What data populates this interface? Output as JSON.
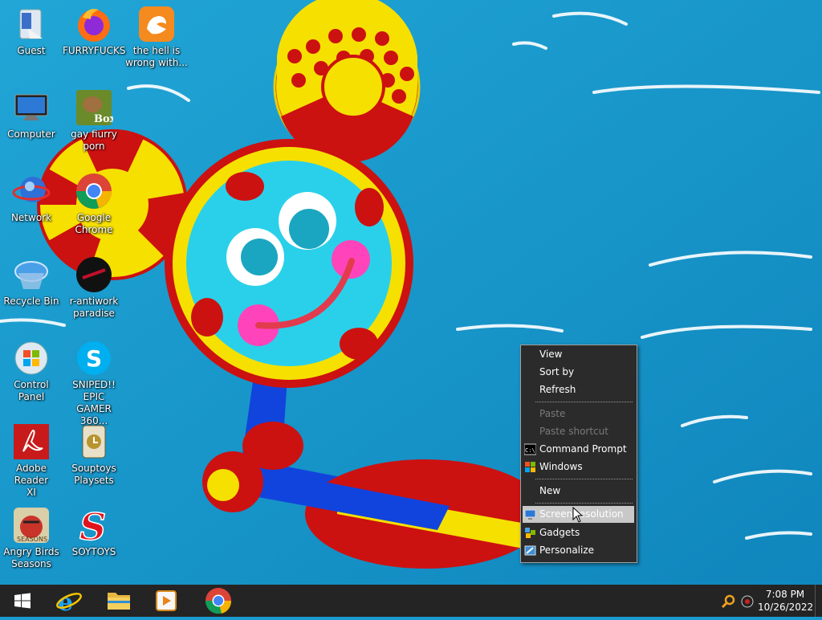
{
  "desktop": {
    "icons": [
      {
        "label": "Guest"
      },
      {
        "label": "FURRYFUCKS"
      },
      {
        "label": "the hell is\nwrong with..."
      },
      {
        "label": "Computer"
      },
      {
        "label": "gay fiurry\nporn"
      },
      {
        "label": "Network"
      },
      {
        "label": "Google\nChrome"
      },
      {
        "label": "Recycle Bin"
      },
      {
        "label": "r-antiwork\nparadise"
      },
      {
        "label": "Control Panel"
      },
      {
        "label": "SNIPED!! EPIC\nGAMER 360..."
      },
      {
        "label": "Adobe Reader\nXI"
      },
      {
        "label": "Souptoys\nPlaysets"
      },
      {
        "label": "Angry Birds\nSeasons"
      },
      {
        "label": "SOYTOYS"
      }
    ],
    "box_badge": "Box",
    "seasons_badge": "SEASONS"
  },
  "context_menu": {
    "items": [
      {
        "label": "View"
      },
      {
        "label": "Sort by"
      },
      {
        "label": "Refresh"
      },
      {
        "label": "Paste"
      },
      {
        "label": "Paste shortcut"
      },
      {
        "label": "Command Prompt"
      },
      {
        "label": "Windows"
      },
      {
        "label": "New"
      },
      {
        "label": "Screen resolution"
      },
      {
        "label": "Gadgets"
      },
      {
        "label": "Personalize"
      }
    ],
    "cmd_icon_text": "C:\\"
  },
  "taskbar": {
    "time": "7:08 PM",
    "date": "10/26/2022"
  },
  "colors": {
    "wallpaper_blue": "#1a9bd0",
    "taskbar": "#242424",
    "menu_bg": "#2b2b2b",
    "menu_hover": "#c8c8c8"
  }
}
